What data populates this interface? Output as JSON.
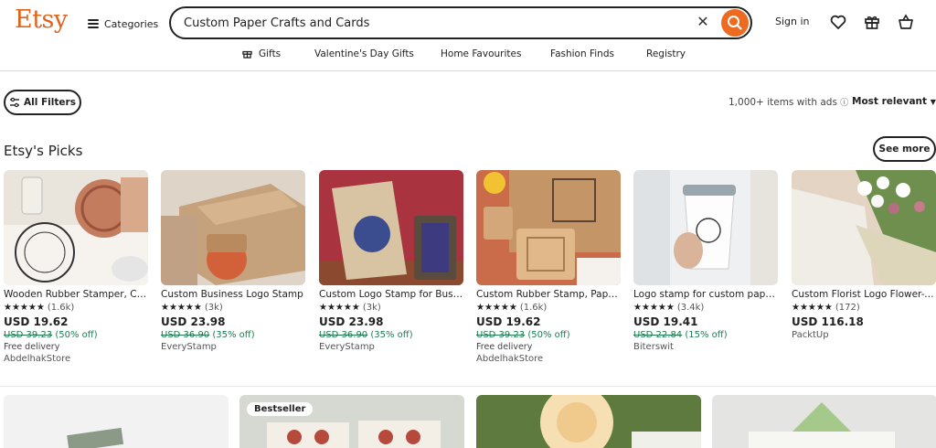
{
  "header": {
    "logo": "Etsy",
    "categories_label": "Categories",
    "search_value": "Custom Paper Crafts and Cards",
    "signin_label": "Sign in"
  },
  "nav": {
    "gifts": "Gifts",
    "valentines": "Valentine's Day Gifts",
    "home": "Home Favourites",
    "fashion": "Fashion Finds",
    "registry": "Registry"
  },
  "toolbar": {
    "all_filters": "All Filters",
    "item_count": "1,000+ items with ads",
    "sort": "Most relevant"
  },
  "picks": {
    "title": "Etsy's Picks",
    "see_more": "See more",
    "items": [
      {
        "title": "Wooden Rubber Stamper, Custom Embroidery Stamp",
        "rating": "(1.6k)",
        "price": "USD 19.62",
        "original": "USD 39.23",
        "discount": "(50% off)",
        "shipping": "Free delivery",
        "shop": "AbdelhakStore"
      },
      {
        "title": "Custom Business Logo Stamp",
        "rating": "(3k)",
        "price": "USD 23.98",
        "original": "USD 36.90",
        "discount": "(35% off)",
        "shipping": "",
        "shop": "EveryStamp"
      },
      {
        "title": "Custom Logo Stamp for Business",
        "rating": "(3k)",
        "price": "USD 23.98",
        "original": "USD 36.90",
        "discount": "(35% off)",
        "shipping": "",
        "shop": "EveryStamp"
      },
      {
        "title": "Custom Rubber Stamp, Paper Stamp",
        "rating": "(1.6k)",
        "price": "USD 19.62",
        "original": "USD 39.23",
        "discount": "(50% off)",
        "shipping": "Free delivery",
        "shop": "AbdelhakStore"
      },
      {
        "title": "Logo stamp for custom paper cups",
        "rating": "(3.4k)",
        "price": "USD 19.41",
        "original": "USD 22.84",
        "discount": "(15% off)",
        "shipping": "",
        "shop": "Biterswit"
      },
      {
        "title": "Custom Florist Logo Flower-Wrap",
        "rating": "(172)",
        "price": "USD 116.18",
        "original": "",
        "discount": "",
        "shipping": "",
        "shop": "PacktUp"
      }
    ]
  },
  "bottom": {
    "bestseller": "Bestseller"
  },
  "colors": {
    "brand": "#e1621a",
    "accent": "#ed6b21",
    "discount": "#1d7a4f"
  },
  "stars": "★★★★★"
}
